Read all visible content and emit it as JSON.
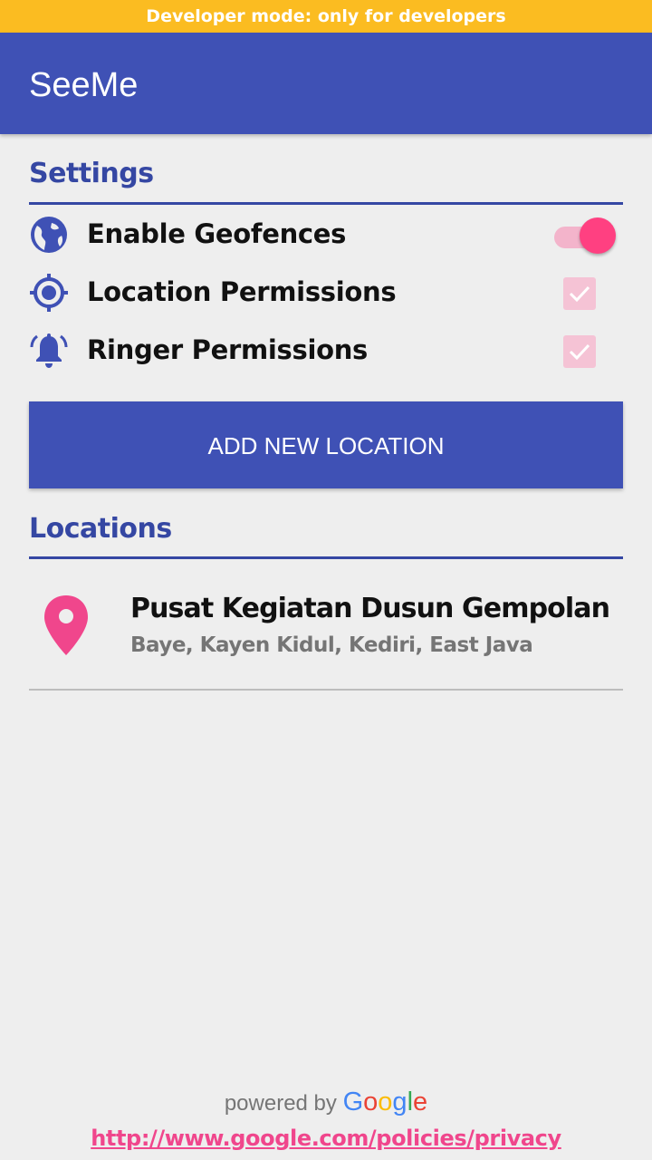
{
  "dev_banner": {
    "text": "Developer mode: only for developers"
  },
  "app_bar": {
    "title": "SeeMe"
  },
  "settings": {
    "title": "Settings",
    "items": [
      {
        "label": "Enable Geofences",
        "icon": "globe-icon",
        "control": "toggle",
        "value": true
      },
      {
        "label": "Location Permissions",
        "icon": "gps-target-icon",
        "control": "checkbox",
        "value": true,
        "disabled": true
      },
      {
        "label": "Ringer Permissions",
        "icon": "bell-ringing-icon",
        "control": "checkbox",
        "value": true,
        "disabled": true
      }
    ]
  },
  "add_button": {
    "label": "ADD NEW LOCATION"
  },
  "locations": {
    "title": "Locations",
    "items": [
      {
        "name": "Pusat Kegiatan Dusun Gempolan",
        "address": "Baye, Kayen Kidul, Kediri, East Java",
        "icon": "map-pin-icon"
      }
    ]
  },
  "footer": {
    "powered_by": "powered by",
    "brand": [
      "G",
      "o",
      "o",
      "g",
      "l",
      "e"
    ],
    "privacy_url": "http://www.google.com/policies/privacy"
  },
  "colors": {
    "primary": "#3f51b5",
    "accent": "#ff4081",
    "banner": "#fbbc21",
    "background": "#eeeeee"
  }
}
